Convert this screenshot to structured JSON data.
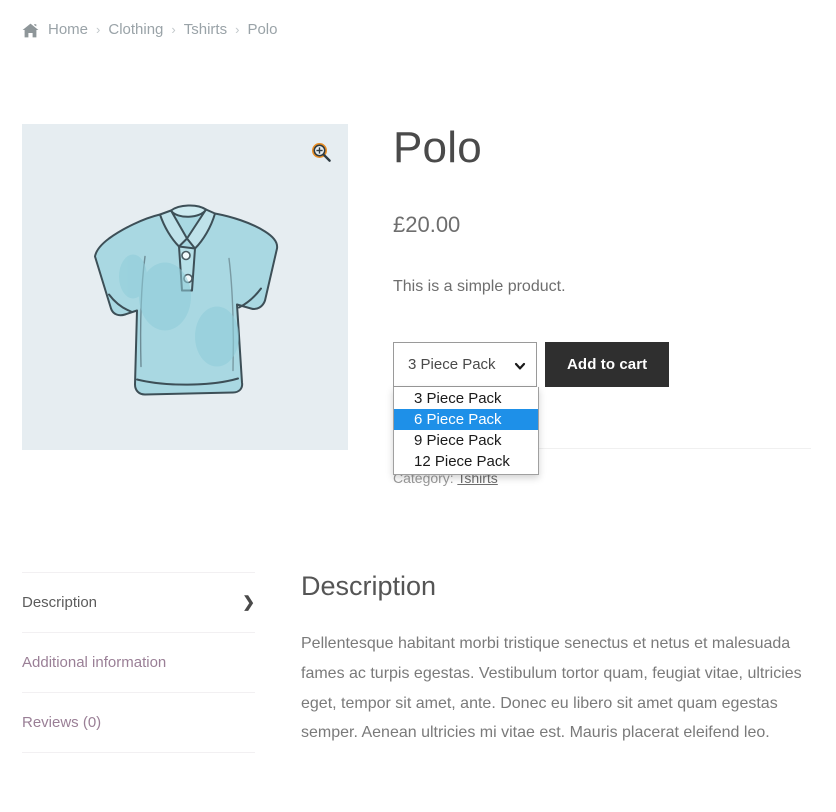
{
  "breadcrumb": {
    "home_icon": "home-icon",
    "separator": "›",
    "items": [
      {
        "label": "Home",
        "current": false
      },
      {
        "label": "Clothing",
        "current": false
      },
      {
        "label": "Tshirts",
        "current": false
      },
      {
        "label": "Polo",
        "current": true
      }
    ]
  },
  "gallery": {
    "zoom_icon": "magnifier-plus-icon",
    "image_alt": "Light blue polo shirt illustration",
    "background_color": "#e6edf1",
    "shirt_color": "#a8d7e0"
  },
  "product": {
    "title": "Polo",
    "price": "£20.00",
    "short_description": "This is a simple product."
  },
  "variation": {
    "selected_value": "3 Piece Pack",
    "chevron_icon": "chevron-down-icon",
    "dropdown_open": true,
    "highlight_color": "#1e90e8",
    "options": [
      {
        "label": "3 Piece Pack",
        "highlighted": false
      },
      {
        "label": "6 Piece Pack",
        "highlighted": true
      },
      {
        "label": "9 Piece Pack",
        "highlighted": false
      },
      {
        "label": "12 Piece Pack",
        "highlighted": false
      }
    ],
    "add_to_cart_label": "Add to cart",
    "button_color": "#2f2f2f"
  },
  "meta": {
    "category_label": "Category:",
    "category_value": "Tshirts"
  },
  "tabs": [
    {
      "label": "Description",
      "active": true,
      "chevron": "❯"
    },
    {
      "label": "Additional information",
      "active": false,
      "chevron": ""
    },
    {
      "label": "Reviews (0)",
      "active": false,
      "chevron": ""
    }
  ],
  "panel": {
    "title": "Description",
    "body": "Pellentesque habitant morbi tristique senectus et netus et malesuada fames ac turpis egestas. Vestibulum tortor quam, feugiat vitae, ultricies eget, tempor sit amet, ante. Donec eu libero sit amet quam egestas semper. Aenean ultricies mi vitae est. Mauris placerat eleifend leo."
  }
}
